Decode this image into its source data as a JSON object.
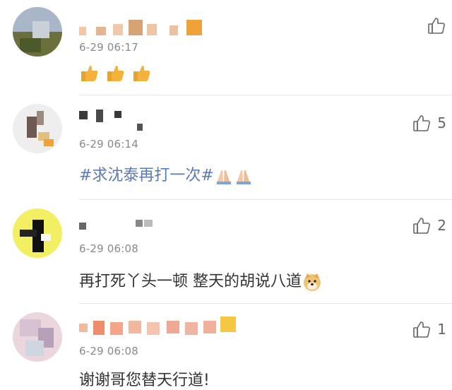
{
  "comments": [
    {
      "time": "6-29 06:17",
      "text": "",
      "likes": "",
      "reaction_icons": [
        "thumbs-up-emoji-icon",
        "thumbs-up-emoji-icon",
        "thumbs-up-emoji-icon"
      ]
    },
    {
      "time": "6-29 06:14",
      "topic": "#求沈泰再打一次#",
      "reaction_icons": [
        "pray-emoji-icon",
        "pray-emoji-icon"
      ],
      "likes": "5"
    },
    {
      "time": "6-29 06:08",
      "text": "再打死丫头一顿 整天的胡说八道",
      "reaction_icons": [
        "doge-emoji-icon"
      ],
      "likes": "2"
    },
    {
      "time": "6-29 06:08",
      "text": "谢谢哥您替天行道!",
      "likes": "1"
    }
  ],
  "icons": {
    "like": "thumbs-up-outline-icon"
  },
  "colors": {
    "topic": "#5b7bb2",
    "meta": "#8a8a8a",
    "divider": "#e6e6e6"
  }
}
